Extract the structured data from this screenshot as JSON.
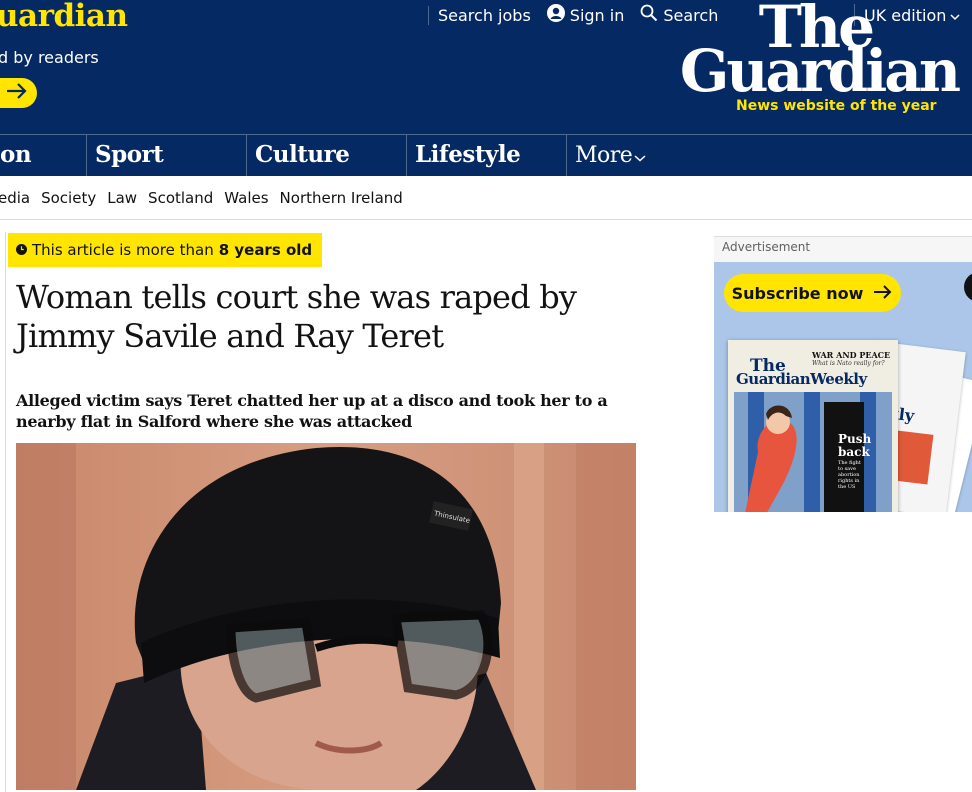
{
  "header": {
    "support_title": "uardian",
    "support_subtitle": "d by readers",
    "top_links": {
      "search_jobs": "Search jobs",
      "sign_in": "Sign in",
      "search": "Search"
    },
    "edition": "UK edition",
    "logo_line1": "The",
    "logo_line2": "Guardian",
    "logo_tagline": "News website of the year"
  },
  "nav": {
    "items": [
      "on",
      "Sport",
      "Culture",
      "Lifestyle"
    ],
    "more": "More"
  },
  "subnav": {
    "items": [
      "edia",
      "Society",
      "Law",
      "Scotland",
      "Wales",
      "Northern Ireland"
    ]
  },
  "article": {
    "age_badge_prefix": "This article is more than",
    "age_badge_value": "8 years old",
    "headline": "Woman tells court she was raped by Jimmy Savile and Ray Teret",
    "standfirst": "Alleged victim says Teret chatted her up at a disco and took her to a nearby flat in Salford where she was attacked"
  },
  "advert": {
    "label": "Advertisement",
    "cta": "Subscribe now",
    "cover_masthead_1": "The",
    "cover_masthead_2": "GuardianWeekly",
    "cover_strap_1": "WAR AND PEACE",
    "cover_strap_2": "What is Nato really for?",
    "cover_headline_1": "Push",
    "cover_headline_2": "back",
    "cover_copy": "The fight to save abortion rights in the US"
  },
  "colors": {
    "brand_blue": "#052962",
    "brand_yellow": "#ffe500",
    "divider_blue": "#506991",
    "ad_background": "#abc6e8"
  },
  "icons": [
    "user-icon",
    "search-icon",
    "chevron-down-icon",
    "arrow-right-icon",
    "clock-icon"
  ]
}
